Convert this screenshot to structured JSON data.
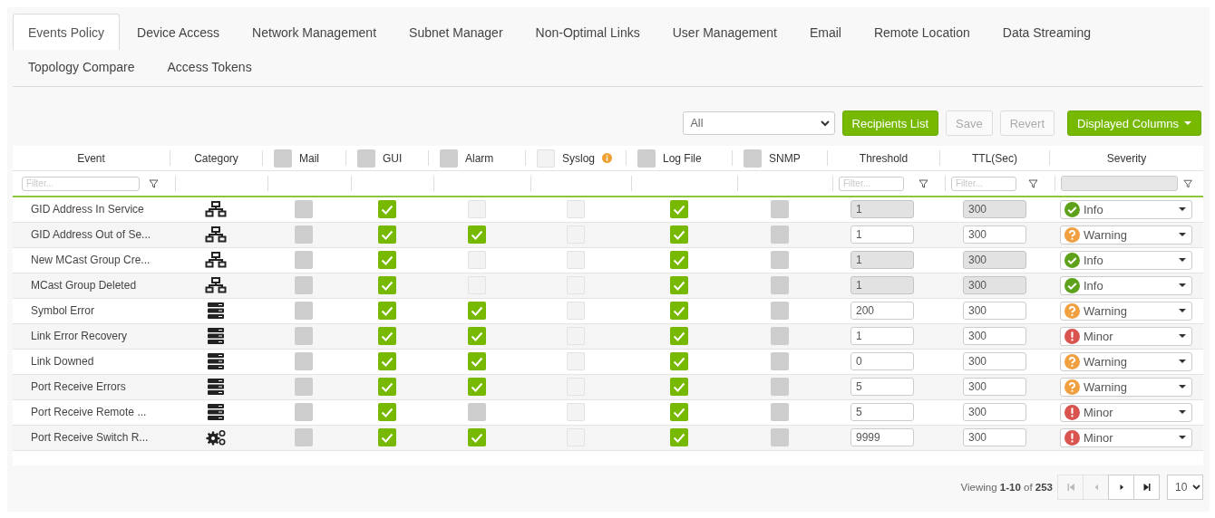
{
  "tabs": [
    {
      "label": "Events Policy",
      "selected": true
    },
    {
      "label": "Device Access",
      "selected": false
    },
    {
      "label": "Network Management",
      "selected": false
    },
    {
      "label": "Subnet Manager",
      "selected": false
    },
    {
      "label": "Non-Optimal Links",
      "selected": false
    },
    {
      "label": "User Management",
      "selected": false
    },
    {
      "label": "Email",
      "selected": false
    },
    {
      "label": "Remote Location",
      "selected": false
    },
    {
      "label": "Data Streaming",
      "selected": false
    },
    {
      "label": "Topology Compare",
      "selected": false
    },
    {
      "label": "Access Tokens",
      "selected": false
    }
  ],
  "toolbar": {
    "filter_select": {
      "value": "All"
    },
    "buttons": [
      {
        "label": "Recipients List",
        "kind": "primary",
        "disabled": false
      },
      {
        "label": "Save",
        "kind": "default",
        "disabled": true
      },
      {
        "label": "Revert",
        "kind": "default",
        "disabled": true
      },
      {
        "label": "Displayed Columns",
        "kind": "dropdown",
        "disabled": false
      }
    ]
  },
  "table": {
    "columns": [
      {
        "label": "Event",
        "kind": "text",
        "filter": {
          "placeholder": "Filter..."
        }
      },
      {
        "label": "Category",
        "kind": "category"
      },
      {
        "label": "Mail",
        "kind": "check",
        "header_checkbox": {
          "checked": false,
          "disabled": false
        }
      },
      {
        "label": "GUI",
        "kind": "check",
        "header_checkbox": {
          "checked": false,
          "disabled": false
        }
      },
      {
        "label": "Alarm",
        "kind": "check",
        "header_checkbox": {
          "checked": false,
          "disabled": false
        }
      },
      {
        "label": "Syslog",
        "kind": "check",
        "info": {
          "kind": "info"
        },
        "header_checkbox": {
          "checked": false,
          "disabled": true
        }
      },
      {
        "label": "Log File",
        "kind": "check",
        "header_checkbox": {
          "checked": false,
          "disabled": false
        }
      },
      {
        "label": "SNMP",
        "kind": "check",
        "header_checkbox": {
          "checked": false,
          "disabled": false
        }
      },
      {
        "label": "Threshold",
        "kind": "number",
        "filter": {
          "placeholder": "Filter..."
        }
      },
      {
        "label": "TTL(Sec)",
        "kind": "number",
        "filter": {
          "placeholder": "Filter..."
        }
      },
      {
        "label": "Severity",
        "kind": "severity",
        "filter": {
          "kind": "select"
        }
      }
    ],
    "rows": [
      {
        "event": "GID Address In Service",
        "category": {
          "kind": "network"
        },
        "mail": {
          "checked": false,
          "disabled": false
        },
        "gui": {
          "checked": true,
          "disabled": false
        },
        "alarm": {
          "checked": false,
          "disabled": true
        },
        "syslog": {
          "checked": false,
          "disabled": true
        },
        "log_file": {
          "checked": true,
          "disabled": false
        },
        "snmp": {
          "checked": false,
          "disabled": false
        },
        "threshold": {
          "value": "1",
          "disabled": true
        },
        "ttl": {
          "value": "300",
          "disabled": true
        },
        "severity": {
          "label": "Info",
          "kind": "info"
        }
      },
      {
        "event": "GID Address Out of Se...",
        "category": {
          "kind": "network"
        },
        "mail": {
          "checked": false,
          "disabled": false
        },
        "gui": {
          "checked": true,
          "disabled": false
        },
        "alarm": {
          "checked": true,
          "disabled": false
        },
        "syslog": {
          "checked": false,
          "disabled": true
        },
        "log_file": {
          "checked": true,
          "disabled": false
        },
        "snmp": {
          "checked": false,
          "disabled": false
        },
        "threshold": {
          "value": "1",
          "disabled": false
        },
        "ttl": {
          "value": "300",
          "disabled": false
        },
        "severity": {
          "label": "Warning",
          "kind": "warning"
        }
      },
      {
        "event": "New MCast Group Cre...",
        "category": {
          "kind": "network"
        },
        "mail": {
          "checked": false,
          "disabled": false
        },
        "gui": {
          "checked": true,
          "disabled": false
        },
        "alarm": {
          "checked": false,
          "disabled": true
        },
        "syslog": {
          "checked": false,
          "disabled": true
        },
        "log_file": {
          "checked": true,
          "disabled": false
        },
        "snmp": {
          "checked": false,
          "disabled": false
        },
        "threshold": {
          "value": "1",
          "disabled": true
        },
        "ttl": {
          "value": "300",
          "disabled": true
        },
        "severity": {
          "label": "Info",
          "kind": "info"
        }
      },
      {
        "event": "MCast Group Deleted",
        "category": {
          "kind": "network"
        },
        "mail": {
          "checked": false,
          "disabled": false
        },
        "gui": {
          "checked": true,
          "disabled": false
        },
        "alarm": {
          "checked": false,
          "disabled": true
        },
        "syslog": {
          "checked": false,
          "disabled": true
        },
        "log_file": {
          "checked": true,
          "disabled": false
        },
        "snmp": {
          "checked": false,
          "disabled": false
        },
        "threshold": {
          "value": "1",
          "disabled": true
        },
        "ttl": {
          "value": "300",
          "disabled": true
        },
        "severity": {
          "label": "Info",
          "kind": "info"
        }
      },
      {
        "event": "Symbol Error",
        "category": {
          "kind": "server"
        },
        "mail": {
          "checked": false,
          "disabled": false
        },
        "gui": {
          "checked": true,
          "disabled": false
        },
        "alarm": {
          "checked": true,
          "disabled": false
        },
        "syslog": {
          "checked": false,
          "disabled": true
        },
        "log_file": {
          "checked": true,
          "disabled": false
        },
        "snmp": {
          "checked": false,
          "disabled": false
        },
        "threshold": {
          "value": "200",
          "disabled": false
        },
        "ttl": {
          "value": "300",
          "disabled": false
        },
        "severity": {
          "label": "Warning",
          "kind": "warning"
        }
      },
      {
        "event": "Link Error Recovery",
        "category": {
          "kind": "server"
        },
        "mail": {
          "checked": false,
          "disabled": false
        },
        "gui": {
          "checked": true,
          "disabled": false
        },
        "alarm": {
          "checked": true,
          "disabled": false
        },
        "syslog": {
          "checked": false,
          "disabled": true
        },
        "log_file": {
          "checked": true,
          "disabled": false
        },
        "snmp": {
          "checked": false,
          "disabled": false
        },
        "threshold": {
          "value": "1",
          "disabled": false
        },
        "ttl": {
          "value": "300",
          "disabled": false
        },
        "severity": {
          "label": "Minor",
          "kind": "minor"
        }
      },
      {
        "event": "Link Downed",
        "category": {
          "kind": "server"
        },
        "mail": {
          "checked": false,
          "disabled": false
        },
        "gui": {
          "checked": true,
          "disabled": false
        },
        "alarm": {
          "checked": true,
          "disabled": false
        },
        "syslog": {
          "checked": false,
          "disabled": true
        },
        "log_file": {
          "checked": true,
          "disabled": false
        },
        "snmp": {
          "checked": false,
          "disabled": false
        },
        "threshold": {
          "value": "0",
          "disabled": false
        },
        "ttl": {
          "value": "300",
          "disabled": false
        },
        "severity": {
          "label": "Warning",
          "kind": "warning"
        }
      },
      {
        "event": "Port Receive Errors",
        "category": {
          "kind": "server"
        },
        "mail": {
          "checked": false,
          "disabled": false
        },
        "gui": {
          "checked": true,
          "disabled": false
        },
        "alarm": {
          "checked": true,
          "disabled": false
        },
        "syslog": {
          "checked": false,
          "disabled": true
        },
        "log_file": {
          "checked": true,
          "disabled": false
        },
        "snmp": {
          "checked": false,
          "disabled": false
        },
        "threshold": {
          "value": "5",
          "disabled": false
        },
        "ttl": {
          "value": "300",
          "disabled": false
        },
        "severity": {
          "label": "Warning",
          "kind": "warning"
        }
      },
      {
        "event": "Port Receive Remote ...",
        "category": {
          "kind": "server"
        },
        "mail": {
          "checked": false,
          "disabled": false
        },
        "gui": {
          "checked": true,
          "disabled": false
        },
        "alarm": {
          "checked": false,
          "disabled": false
        },
        "syslog": {
          "checked": false,
          "disabled": true
        },
        "log_file": {
          "checked": true,
          "disabled": false
        },
        "snmp": {
          "checked": false,
          "disabled": false
        },
        "threshold": {
          "value": "5",
          "disabled": false
        },
        "ttl": {
          "value": "300",
          "disabled": false
        },
        "severity": {
          "label": "Minor",
          "kind": "minor"
        }
      },
      {
        "event": "Port Receive Switch R...",
        "category": {
          "kind": "gears"
        },
        "mail": {
          "checked": false,
          "disabled": false
        },
        "gui": {
          "checked": true,
          "disabled": false
        },
        "alarm": {
          "checked": true,
          "disabled": false
        },
        "syslog": {
          "checked": false,
          "disabled": true
        },
        "log_file": {
          "checked": true,
          "disabled": false
        },
        "snmp": {
          "checked": false,
          "disabled": false
        },
        "threshold": {
          "value": "9999",
          "disabled": false
        },
        "ttl": {
          "value": "300",
          "disabled": false
        },
        "severity": {
          "label": "Minor",
          "kind": "minor"
        }
      }
    ]
  },
  "pagination": {
    "viewing": "Viewing **1-10** of **253**",
    "buttons": [
      {
        "kind": "first",
        "disabled": true
      },
      {
        "kind": "prev",
        "disabled": true
      },
      {
        "kind": "next",
        "disabled": false
      },
      {
        "kind": "last",
        "disabled": false
      }
    ],
    "page_size": "10"
  }
}
